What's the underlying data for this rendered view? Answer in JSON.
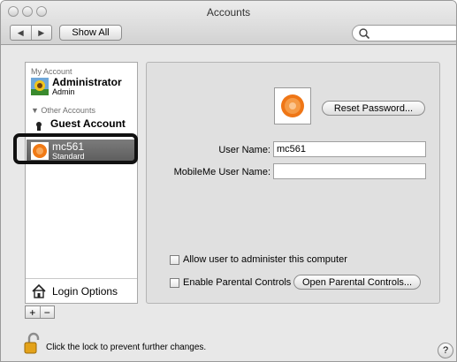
{
  "window": {
    "title": "Accounts"
  },
  "toolbar": {
    "show_all_label": "Show All",
    "back_glyph": "◀",
    "forward_glyph": "▶"
  },
  "search": {
    "value": "",
    "placeholder": ""
  },
  "sidebar": {
    "my_account_header": "My Account",
    "other_accounts_header": "▼ Other Accounts",
    "items": [
      {
        "name": "Administrator",
        "sub": "Admin",
        "icon": "flower-user-icon"
      },
      {
        "name": "Guest Account",
        "sub": "",
        "icon": "guest-user-icon"
      },
      {
        "name": "mc561",
        "sub": "Standard",
        "icon": "orange-user-icon"
      }
    ],
    "login_options_label": "Login Options",
    "add_label": "+",
    "remove_label": "−"
  },
  "panel": {
    "reset_password_label": "Reset Password...",
    "user_name_label": "User Name:",
    "user_name_value": "mc561",
    "mobileme_label": "MobileMe User Name:",
    "mobileme_value": "",
    "allow_admin_label": "Allow user to administer this computer",
    "parental_label": "Enable Parental Controls",
    "open_parental_label": "Open Parental Controls..."
  },
  "footer": {
    "lock_text": "Click the lock to prevent further changes.",
    "help_label": "?"
  }
}
